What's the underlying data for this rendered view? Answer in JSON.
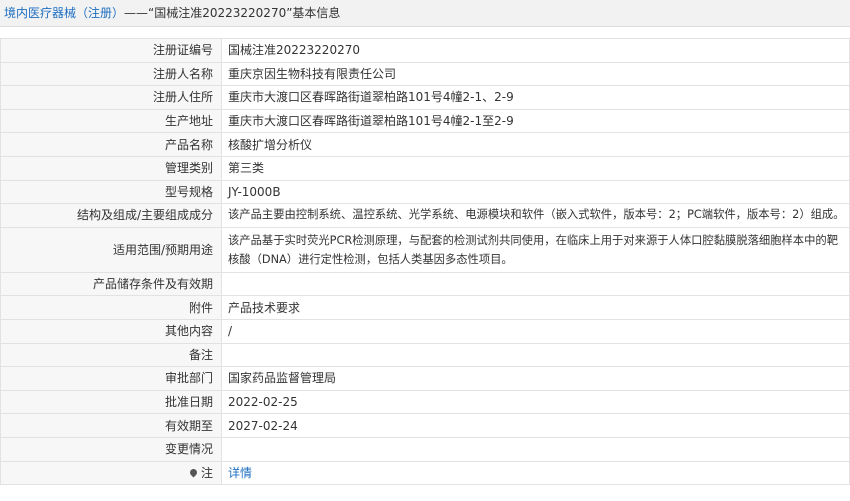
{
  "header": {
    "breadcrumb_link": "境内医疗器械（注册）",
    "breadcrumb_rest": "——“国械注准20223220270”基本信息"
  },
  "rows": [
    {
      "label": "注册证编号",
      "value": "国械注准20223220270"
    },
    {
      "label": "注册人名称",
      "value": "重庆京因生物科技有限责任公司"
    },
    {
      "label": "注册人住所",
      "value": "重庆市大渡口区春晖路街道翠柏路101号4幢2-1、2-9"
    },
    {
      "label": "生产地址",
      "value": "重庆市大渡口区春晖路街道翠柏路101号4幢2-1至2-9"
    },
    {
      "label": "产品名称",
      "value": "核酸扩增分析仪"
    },
    {
      "label": "管理类别",
      "value": "第三类"
    },
    {
      "label": "型号规格",
      "value": "JY-1000B"
    },
    {
      "label": "结构及组成/主要组成成分",
      "value": "该产品主要由控制系统、温控系统、光学系统、电源模块和软件（嵌入式软件，版本号：2；PC端软件，版本号：2）组成。"
    },
    {
      "label": "适用范围/预期用途",
      "value": "该产品基于实时荧光PCR检测原理，与配套的检测试剂共同使用，在临床上用于对来源于人体口腔黏膜脱落细胞样本中的靶核酸（DNA）进行定性检测，包括人类基因多态性项目。"
    },
    {
      "label": "产品储存条件及有效期",
      "value": ""
    },
    {
      "label": "附件",
      "value": "产品技术要求"
    },
    {
      "label": "其他内容",
      "value": "/"
    },
    {
      "label": "备注",
      "value": ""
    },
    {
      "label": "审批部门",
      "value": "国家药品监督管理局"
    },
    {
      "label": "批准日期",
      "value": "2022-02-25"
    },
    {
      "label": "有效期至",
      "value": "2027-02-24"
    },
    {
      "label": "变更情况",
      "value": ""
    },
    {
      "label": "注",
      "value": "详情"
    }
  ],
  "colors": {
    "link": "#1e6fc2",
    "label_bg": "#f7f7f7",
    "border": "#e2e2e2"
  },
  "icons": {
    "note": "pin-icon"
  }
}
